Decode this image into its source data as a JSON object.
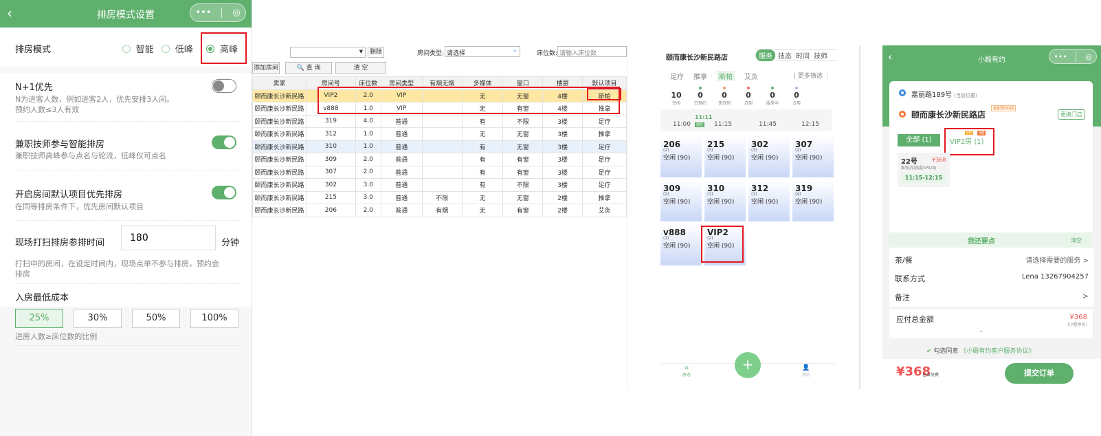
{
  "settings": {
    "nav_title": "排房模式设置",
    "mode_label": "排房模式",
    "modes": [
      "智能",
      "低峰",
      "高峰"
    ],
    "n1_title": "N+1优先",
    "n1_desc1": "N为进客人数，例如进客2人，优先安排3人间。",
    "n1_desc2": "预约人数≤3人有效",
    "parttime_title": "兼职技师参与智能排房",
    "parttime_desc": "兼职技师高峰参与点名与轮流，低峰仅可点名",
    "default_title": "开启房间默认项目优先排房",
    "default_desc": "在同等排房条件下，优先房间默认项目",
    "clean_label": "现场打扫排房参排时间",
    "clean_value": "180",
    "clean_unit": "分钟",
    "clean_desc1": "打扫中的房间，在设定时间内，现场点单不参与排房，预约会",
    "clean_desc2": "排房",
    "cost_title": "入房最低成本",
    "cost_options": [
      "25%",
      "30%",
      "50%",
      "100%"
    ],
    "cost_desc": "进房人数≥床位数的比例",
    "accent": "#5fb06d"
  },
  "table": {
    "delete_label": "删除",
    "room_type_label": "房间类型:",
    "room_type_value": "请选择",
    "bed_label": "床位数:",
    "bed_placeholder": "请输入床位数",
    "add_label": "添加房间",
    "query_label": "查 询",
    "clear_label": "清 空",
    "headers": [
      "卖家",
      "房间号",
      "床位数",
      "房间类型",
      "有烟无烟",
      "多媒体",
      "窗口",
      "楼层",
      "默认项目"
    ],
    "rows": [
      [
        "颐而康长沙新民路",
        "VIP2",
        "2.0",
        "VIP",
        "",
        "无",
        "无窗",
        "4楼",
        "斯帕"
      ],
      [
        "颐而康长沙新民路",
        "v888",
        "1.0",
        "VIP",
        "",
        "无",
        "有窗",
        "4楼",
        "推拿"
      ],
      [
        "颐而康长沙新民路",
        "319",
        "4.0",
        "普通",
        "",
        "有",
        "不限",
        "3楼",
        "足疗"
      ],
      [
        "颐而康长沙新民路",
        "312",
        "1.0",
        "普通",
        "",
        "无",
        "无窗",
        "3楼",
        "推拿"
      ],
      [
        "颐而康长沙新民路",
        "310",
        "1.0",
        "普通",
        "",
        "有",
        "无窗",
        "3楼",
        "足疗"
      ],
      [
        "颐而康长沙新民路",
        "309",
        "2.0",
        "普通",
        "",
        "有",
        "有窗",
        "3楼",
        "足疗"
      ],
      [
        "颐而康长沙新民路",
        "307",
        "2.0",
        "普通",
        "",
        "有",
        "有窗",
        "3楼",
        "足疗"
      ],
      [
        "颐而康长沙新民路",
        "302",
        "3.0",
        "普通",
        "",
        "有",
        "不限",
        "3楼",
        "足疗"
      ],
      [
        "颐而康长沙新民路",
        "215",
        "3.0",
        "普通",
        "不限",
        "无",
        "无窗",
        "2楼",
        "推拿"
      ],
      [
        "颐而康长沙新民路",
        "206",
        "2.0",
        "普通",
        "有烟",
        "无",
        "有窗",
        "2楼",
        "艾灸"
      ]
    ]
  },
  "rooms_app": {
    "store": "颐而康长沙新民路店",
    "tabs": [
      "服务",
      "技态",
      "时间",
      "技师"
    ],
    "cats": [
      "足疗",
      "推拿",
      "斯帕",
      "艾灸"
    ],
    "more": "更多筛选",
    "stats": [
      {
        "n": "10",
        "t": "空闲",
        "c": "#ffffff"
      },
      {
        "n": "0",
        "t": "已预约",
        "c": "#5fb06d"
      },
      {
        "n": "0",
        "t": "快迟到",
        "c": "#f0a060"
      },
      {
        "n": "0",
        "t": "迟到",
        "c": "#f07070"
      },
      {
        "n": "0",
        "t": "服务中",
        "c": "#5fb06d"
      },
      {
        "n": "0",
        "t": "占用",
        "c": "#b0b8e0"
      }
    ],
    "now_time": "11:11",
    "now_badge": "现在",
    "times": [
      "11:00",
      "11:15",
      "11:45",
      "12:15"
    ],
    "rooms": [
      {
        "name": "206",
        "cap": "(2)",
        "st": "空闲 (90)"
      },
      {
        "name": "215",
        "cap": "(3)",
        "st": "空闲 (90)"
      },
      {
        "name": "302",
        "cap": "(3)",
        "st": "空闲 (90)"
      },
      {
        "name": "307",
        "cap": "(2)",
        "st": "空闲 (90)"
      },
      {
        "name": "309",
        "cap": "(2)",
        "st": "空闲 (90)"
      },
      {
        "name": "310",
        "cap": "(1)",
        "st": "空闲 (90)"
      },
      {
        "name": "312",
        "cap": "(1)",
        "st": "空闲 (90)"
      },
      {
        "name": "319",
        "cap": "(4)",
        "st": "空闲 (90)"
      },
      {
        "name": "v888",
        "cap": "(1)",
        "st": "空闲 (90)"
      },
      {
        "name": "VIP2",
        "cap": "(2)",
        "st": "空闲 (90)"
      }
    ],
    "bottom_left": "房态",
    "bottom_right": "我的"
  },
  "booking": {
    "title": "小殿有约",
    "addr": "嘉丽路189号",
    "addr_note": "(当前位置)",
    "store": "颐而康长沙新民路店",
    "store_tag": "查看预约时间",
    "switch": "更换门店",
    "all_tab": "全部 (1)",
    "vip_tab": "VIP2房 (1)",
    "tag_vip": "VIP",
    "tag_4f": "4楼",
    "tech_no": "22号",
    "tech_price": "¥368",
    "tech_desc": "斯帕/加强嘉SPA/局",
    "tech_time": "11:15-12:15",
    "want": "我还要点",
    "clear": "清空",
    "tea_label": "茶/餐",
    "tea_value": "请选择需要的服务 >",
    "contact_label": "联系方式",
    "contact_value": "Lena 13267904257",
    "note_label": "备注",
    "note_value": ">",
    "total_label": "应付总金额",
    "total_value": "¥368",
    "total_note": "(小程序价)",
    "agree": "勾选同意",
    "agree_link": "《小殿有约客户服务协议》",
    "price_big": "368",
    "price_sub": "已含房费",
    "submit": "提交订单"
  }
}
